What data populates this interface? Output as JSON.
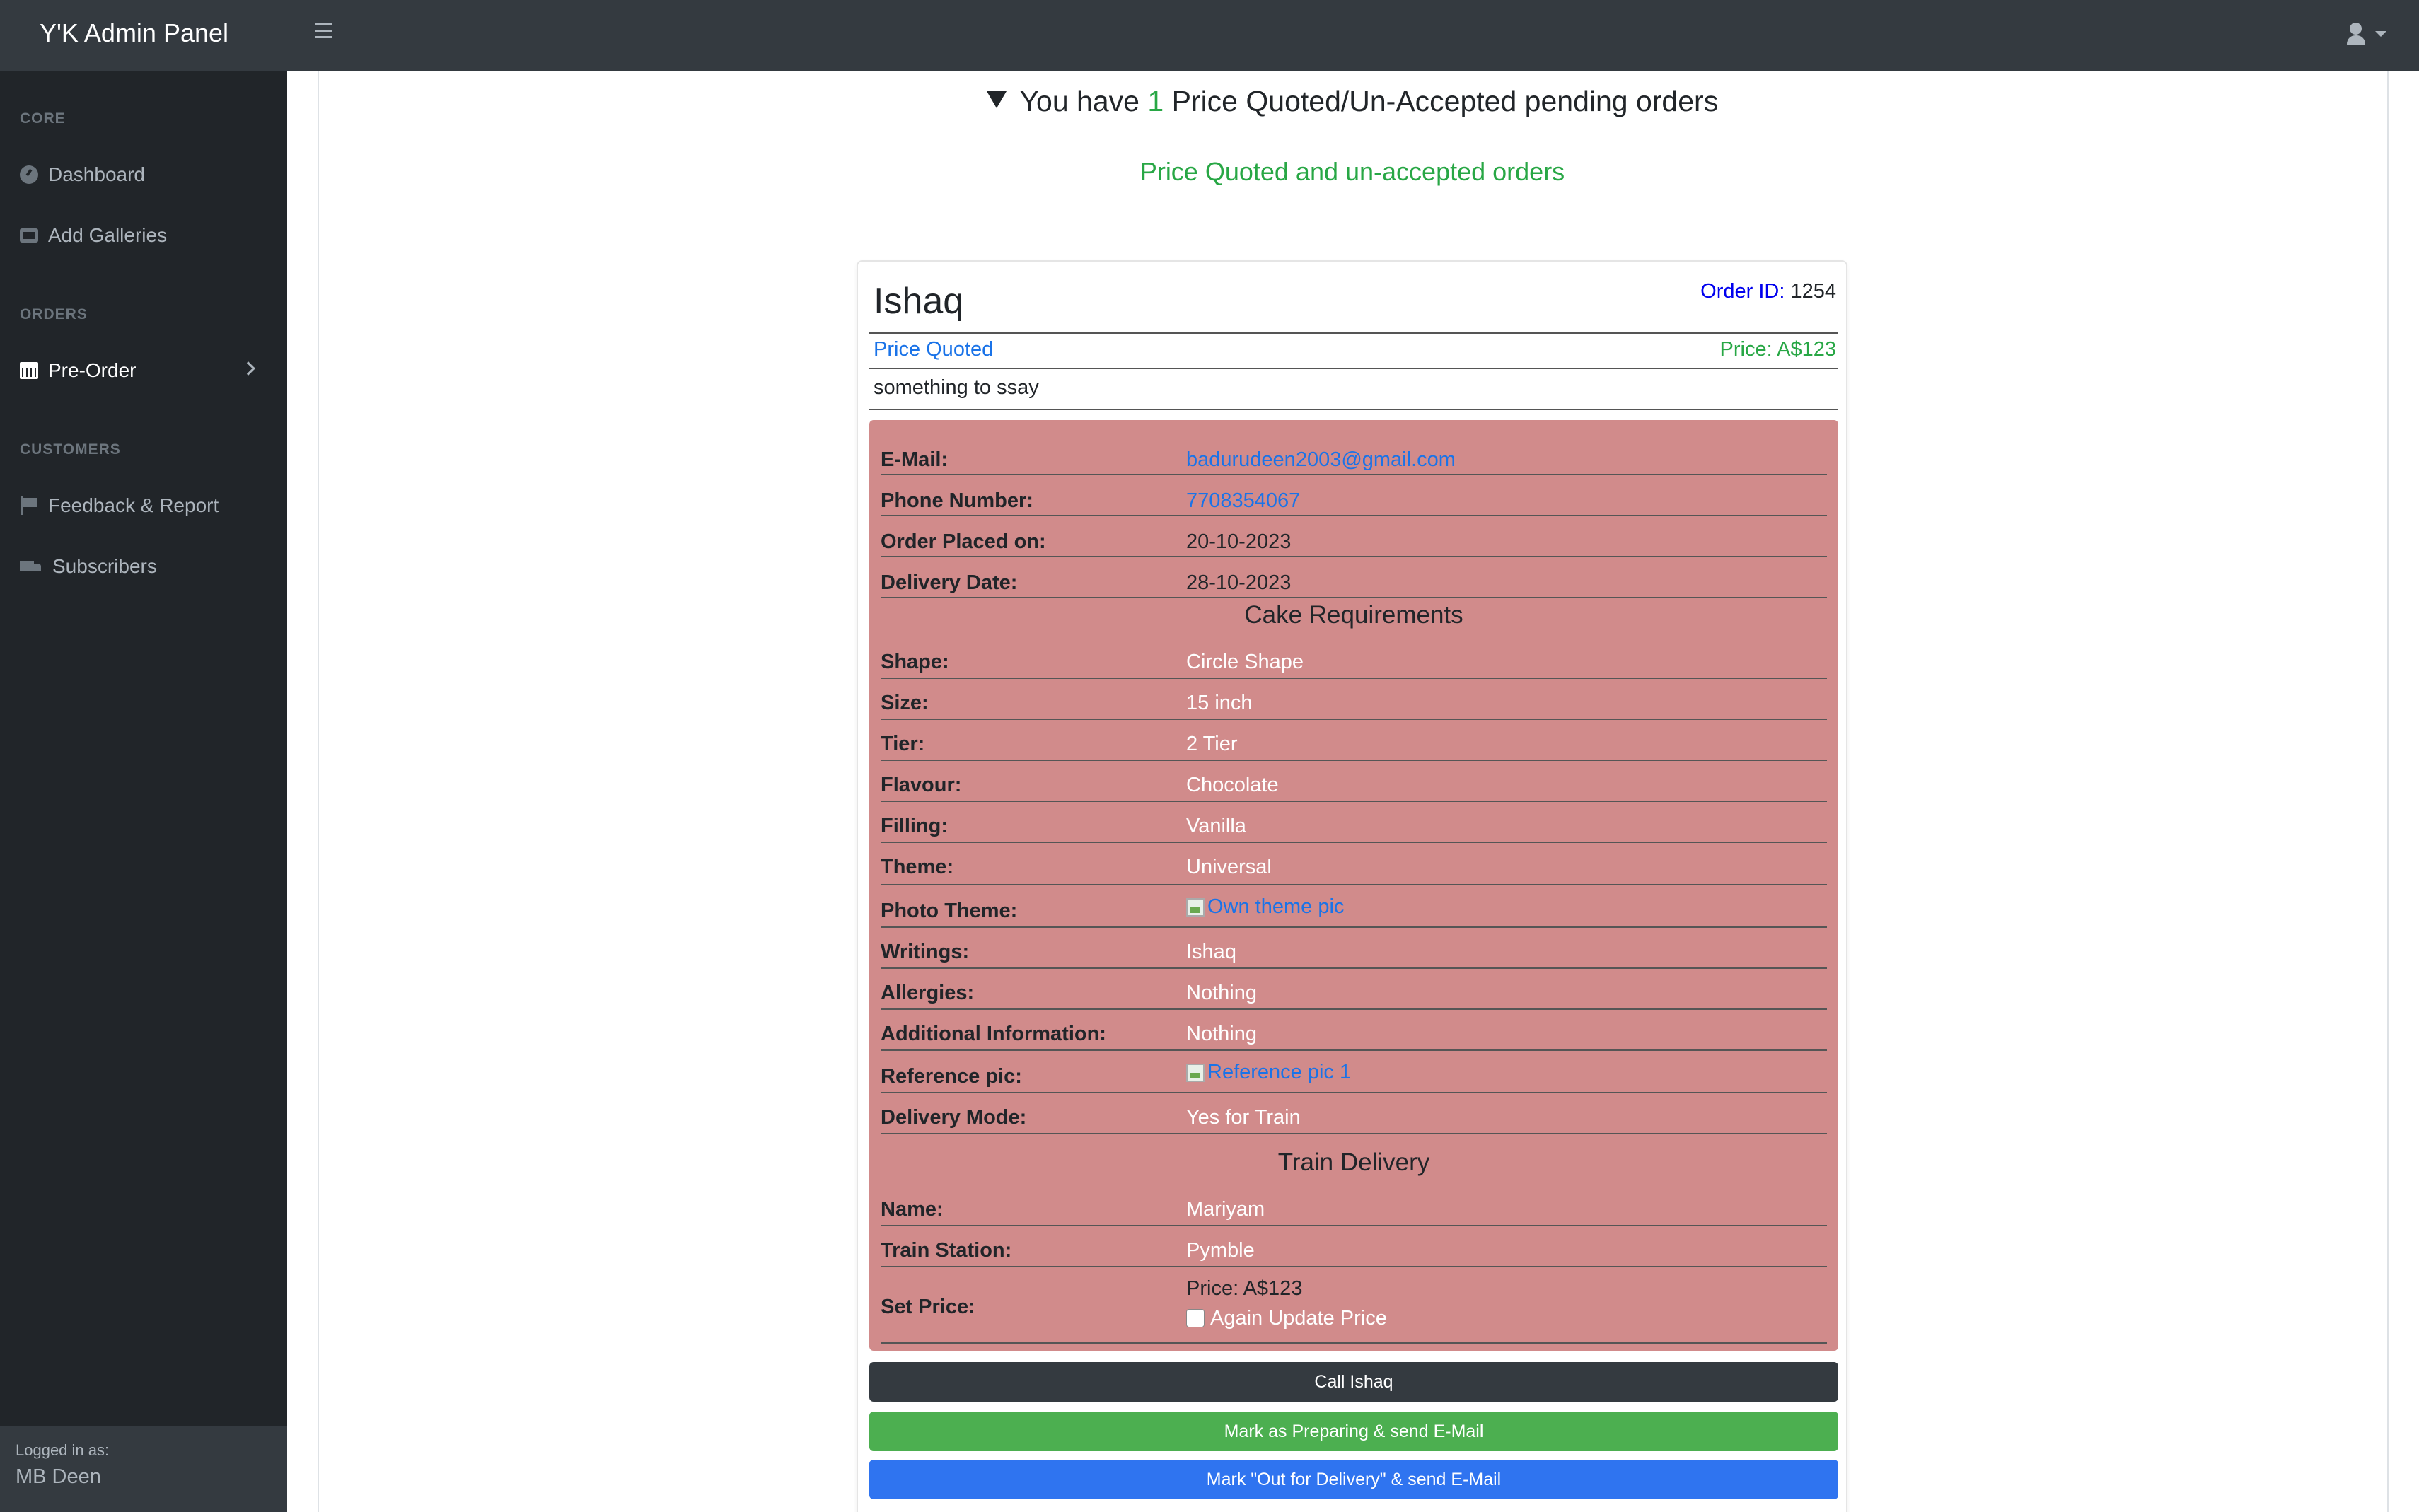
{
  "navbar": {
    "brand": "Y'K Admin Panel",
    "toggle_icon": "hamburger-icon",
    "user_icon": "user-icon"
  },
  "sidebar": {
    "headings": {
      "core": "CORE",
      "orders": "ORDERS",
      "customers": "CUSTOMERS"
    },
    "items": [
      {
        "label": "Dashboard",
        "icon": "dashboard-icon"
      },
      {
        "label": "Add Galleries",
        "icon": "gallery-icon"
      },
      {
        "label": "Pre-Order",
        "icon": "calendar-icon",
        "active": true
      },
      {
        "label": "Feedback & Report",
        "icon": "flag-icon"
      },
      {
        "label": "Subscribers",
        "icon": "truck-icon"
      }
    ],
    "footer": {
      "logged_in_label": "Logged in as:",
      "user": "MB Deen"
    }
  },
  "main": {
    "pending_prefix": "You have",
    "pending_count": "1",
    "pending_suffix": "Price Quoted/Un-Accepted pending orders",
    "subtitle": "Price Quoted and un-accepted orders"
  },
  "order": {
    "customer_name": "Ishaq",
    "order_id_label": "Order ID:",
    "order_id": "1254",
    "status": "Price Quoted",
    "price_label": "Price: A$123",
    "note": "something to ssay",
    "contact": [
      {
        "key": "E-Mail:",
        "value": "badurudeen2003@gmail.com"
      },
      {
        "key": "Phone Number:",
        "value": "7708354067"
      },
      {
        "key": "Order Placed on:",
        "value": "20-10-2023"
      },
      {
        "key": "Delivery Date:",
        "value": "28-10-2023"
      }
    ],
    "cake_title": "Cake Requirements",
    "cake": [
      {
        "key": "Shape:",
        "value": "Circle Shape"
      },
      {
        "key": "Size:",
        "value": "15 inch"
      },
      {
        "key": "Tier:",
        "value": "2 Tier"
      },
      {
        "key": "Flavour:",
        "value": "Chocolate"
      },
      {
        "key": "Filling:",
        "value": "Vanilla"
      },
      {
        "key": "Theme:",
        "value": "Universal"
      },
      {
        "key": "Photo Theme:",
        "value": "Own theme pic"
      },
      {
        "key": "Writings:",
        "value": "Ishaq"
      },
      {
        "key": "Allergies:",
        "value": "Nothing"
      },
      {
        "key": "Additional Information:",
        "value": "Nothing"
      },
      {
        "key": "Reference pic:",
        "value": "Reference pic 1"
      },
      {
        "key": "Delivery Mode:",
        "value": "Yes for Train"
      }
    ],
    "train_title": "Train Delivery",
    "train": [
      {
        "key": "Name:",
        "value": "Mariyam"
      },
      {
        "key": "Train Station:",
        "value": "Pymble"
      }
    ],
    "set_price": {
      "key": "Set Price:",
      "value": "Price: A$123",
      "checkbox_label": "Again Update Price",
      "checked": false
    },
    "buttons": {
      "call": "Call Ishaq",
      "preparing": "Mark as Preparing & send E-Mail",
      "out_for_delivery": "Mark \"Out for Delivery\" & send E-Mail"
    }
  }
}
